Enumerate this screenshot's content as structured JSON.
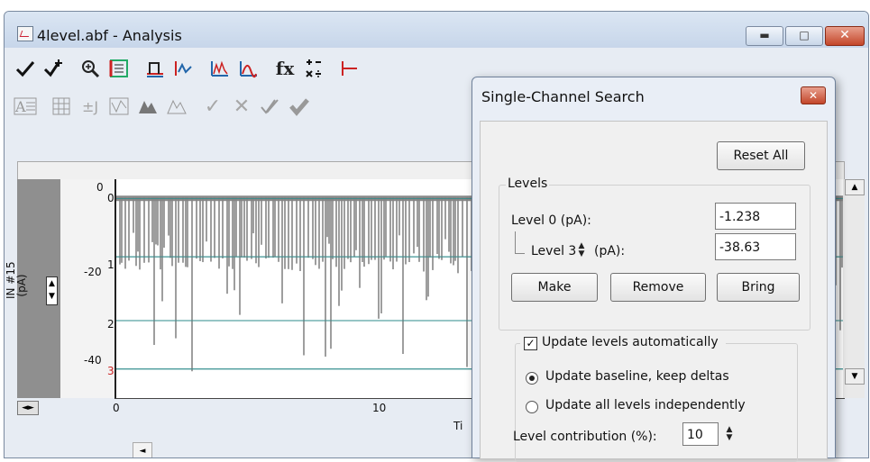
{
  "window": {
    "title": "4level.abf - Analysis"
  },
  "caption_buttons": {
    "minimize": "▬",
    "maximize": "□",
    "close": "✕"
  },
  "toolbar1": {
    "icons": [
      "check-icon",
      "check-plus-icon",
      "zoom-in-icon",
      "fit-icon",
      "baseline-icon",
      "cursor-adjust-icon",
      "histogram-icon",
      "histogram-overlay-icon",
      "function-icon",
      "arithmetic-icon",
      "signal-icon",
      "level-icon",
      "table-icon",
      "disabled-icon",
      "disabled-icon",
      "event-icon",
      "event-icon"
    ],
    "labels": {
      "check": "✓",
      "fx": "fx"
    }
  },
  "toolbar2": {
    "glyphs": {
      "check": "✓",
      "cross": "✕"
    }
  },
  "plot": {
    "y_channel_label": "IN #15\n(pA)",
    "y_ticks": [
      "0",
      "-20",
      "-40"
    ],
    "level_marks": [
      "0",
      "1",
      "2",
      "3"
    ],
    "x_ticks": [
      "0",
      "10"
    ],
    "x_label_partial": "Ti"
  },
  "chart_data": {
    "type": "line",
    "xlabel": "Ti",
    "ylabel": "IN #15 (pA)",
    "x_ticks": [
      0,
      10
    ],
    "y_ticks": [
      0,
      -20,
      -40
    ],
    "levels": [
      {
        "name": "0",
        "value_pA": -1.238
      },
      {
        "name": "1",
        "value_pA": -14
      },
      {
        "name": "2",
        "value_pA": -28
      },
      {
        "name": "3",
        "value_pA": -38.63
      }
    ],
    "series": [
      {
        "name": "IN #15",
        "values": []
      }
    ]
  },
  "dialog": {
    "title": "Single-Channel Search",
    "close_glyph": "✕",
    "reset_all": "Reset All",
    "levels_group": "Levels",
    "level0_label": "Level 0 (pA):",
    "level0_value": "-1.238",
    "level3_label": "Level 3",
    "level3_unit": "(pA):",
    "level3_value": "-38.63",
    "make": "Make",
    "remove": "Remove",
    "bring": "Bring",
    "update_auto_label": "Update levels automatically",
    "update_auto_checked": "✓",
    "radio1": "Update baseline, keep deltas",
    "radio2": "Update all levels independently",
    "contrib_label": "Level contribution (%):",
    "contrib_value": "10"
  }
}
